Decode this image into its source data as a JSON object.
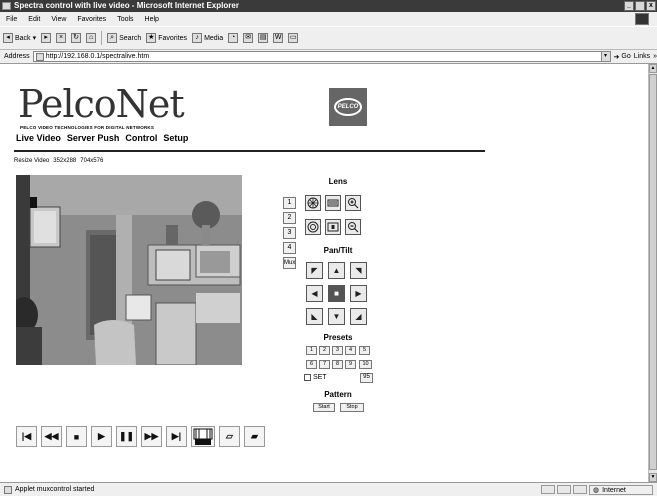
{
  "window": {
    "title": "Spectra control with live video - Microsoft Internet Explorer",
    "min_label": "_",
    "max_label": " ",
    "close_label": "x"
  },
  "menubar": [
    "File",
    "Edit",
    "View",
    "Favorites",
    "Tools",
    "Help"
  ],
  "toolbar": {
    "back": "Back",
    "search": "Search",
    "favorites": "Favorites",
    "media": "Media"
  },
  "address": {
    "label": "Address",
    "url": "http://192.168.0.1/spectralive.htm",
    "go": "Go",
    "links": "Links"
  },
  "page": {
    "logo": "PelcoNet",
    "tagline": "PELCO VIDEO TECHNOLOGIES FOR DIGITAL NETWORKS",
    "pelco_badge": "PELCO",
    "nav": [
      "Live Video",
      "Server Push",
      "Control",
      "Setup"
    ],
    "resize_label": "Resize Video",
    "resize_options": [
      "352x288",
      "704x576"
    ]
  },
  "cameras": [
    "1",
    "2",
    "3",
    "4",
    "Mux"
  ],
  "lens": {
    "title": "Lens"
  },
  "pantilt": {
    "title": "Pan/Tilt"
  },
  "presets": {
    "title": "Presets",
    "buttons": [
      "1",
      "2",
      "3",
      "4",
      "5",
      "6",
      "7",
      "8",
      "9",
      "10"
    ],
    "set_label": "SET",
    "set_value": "95"
  },
  "pattern": {
    "title": "Pattern",
    "start": "Start",
    "stop": "Stop"
  },
  "status": {
    "text": "Applet muxcontrol started",
    "zone": "Internet"
  }
}
